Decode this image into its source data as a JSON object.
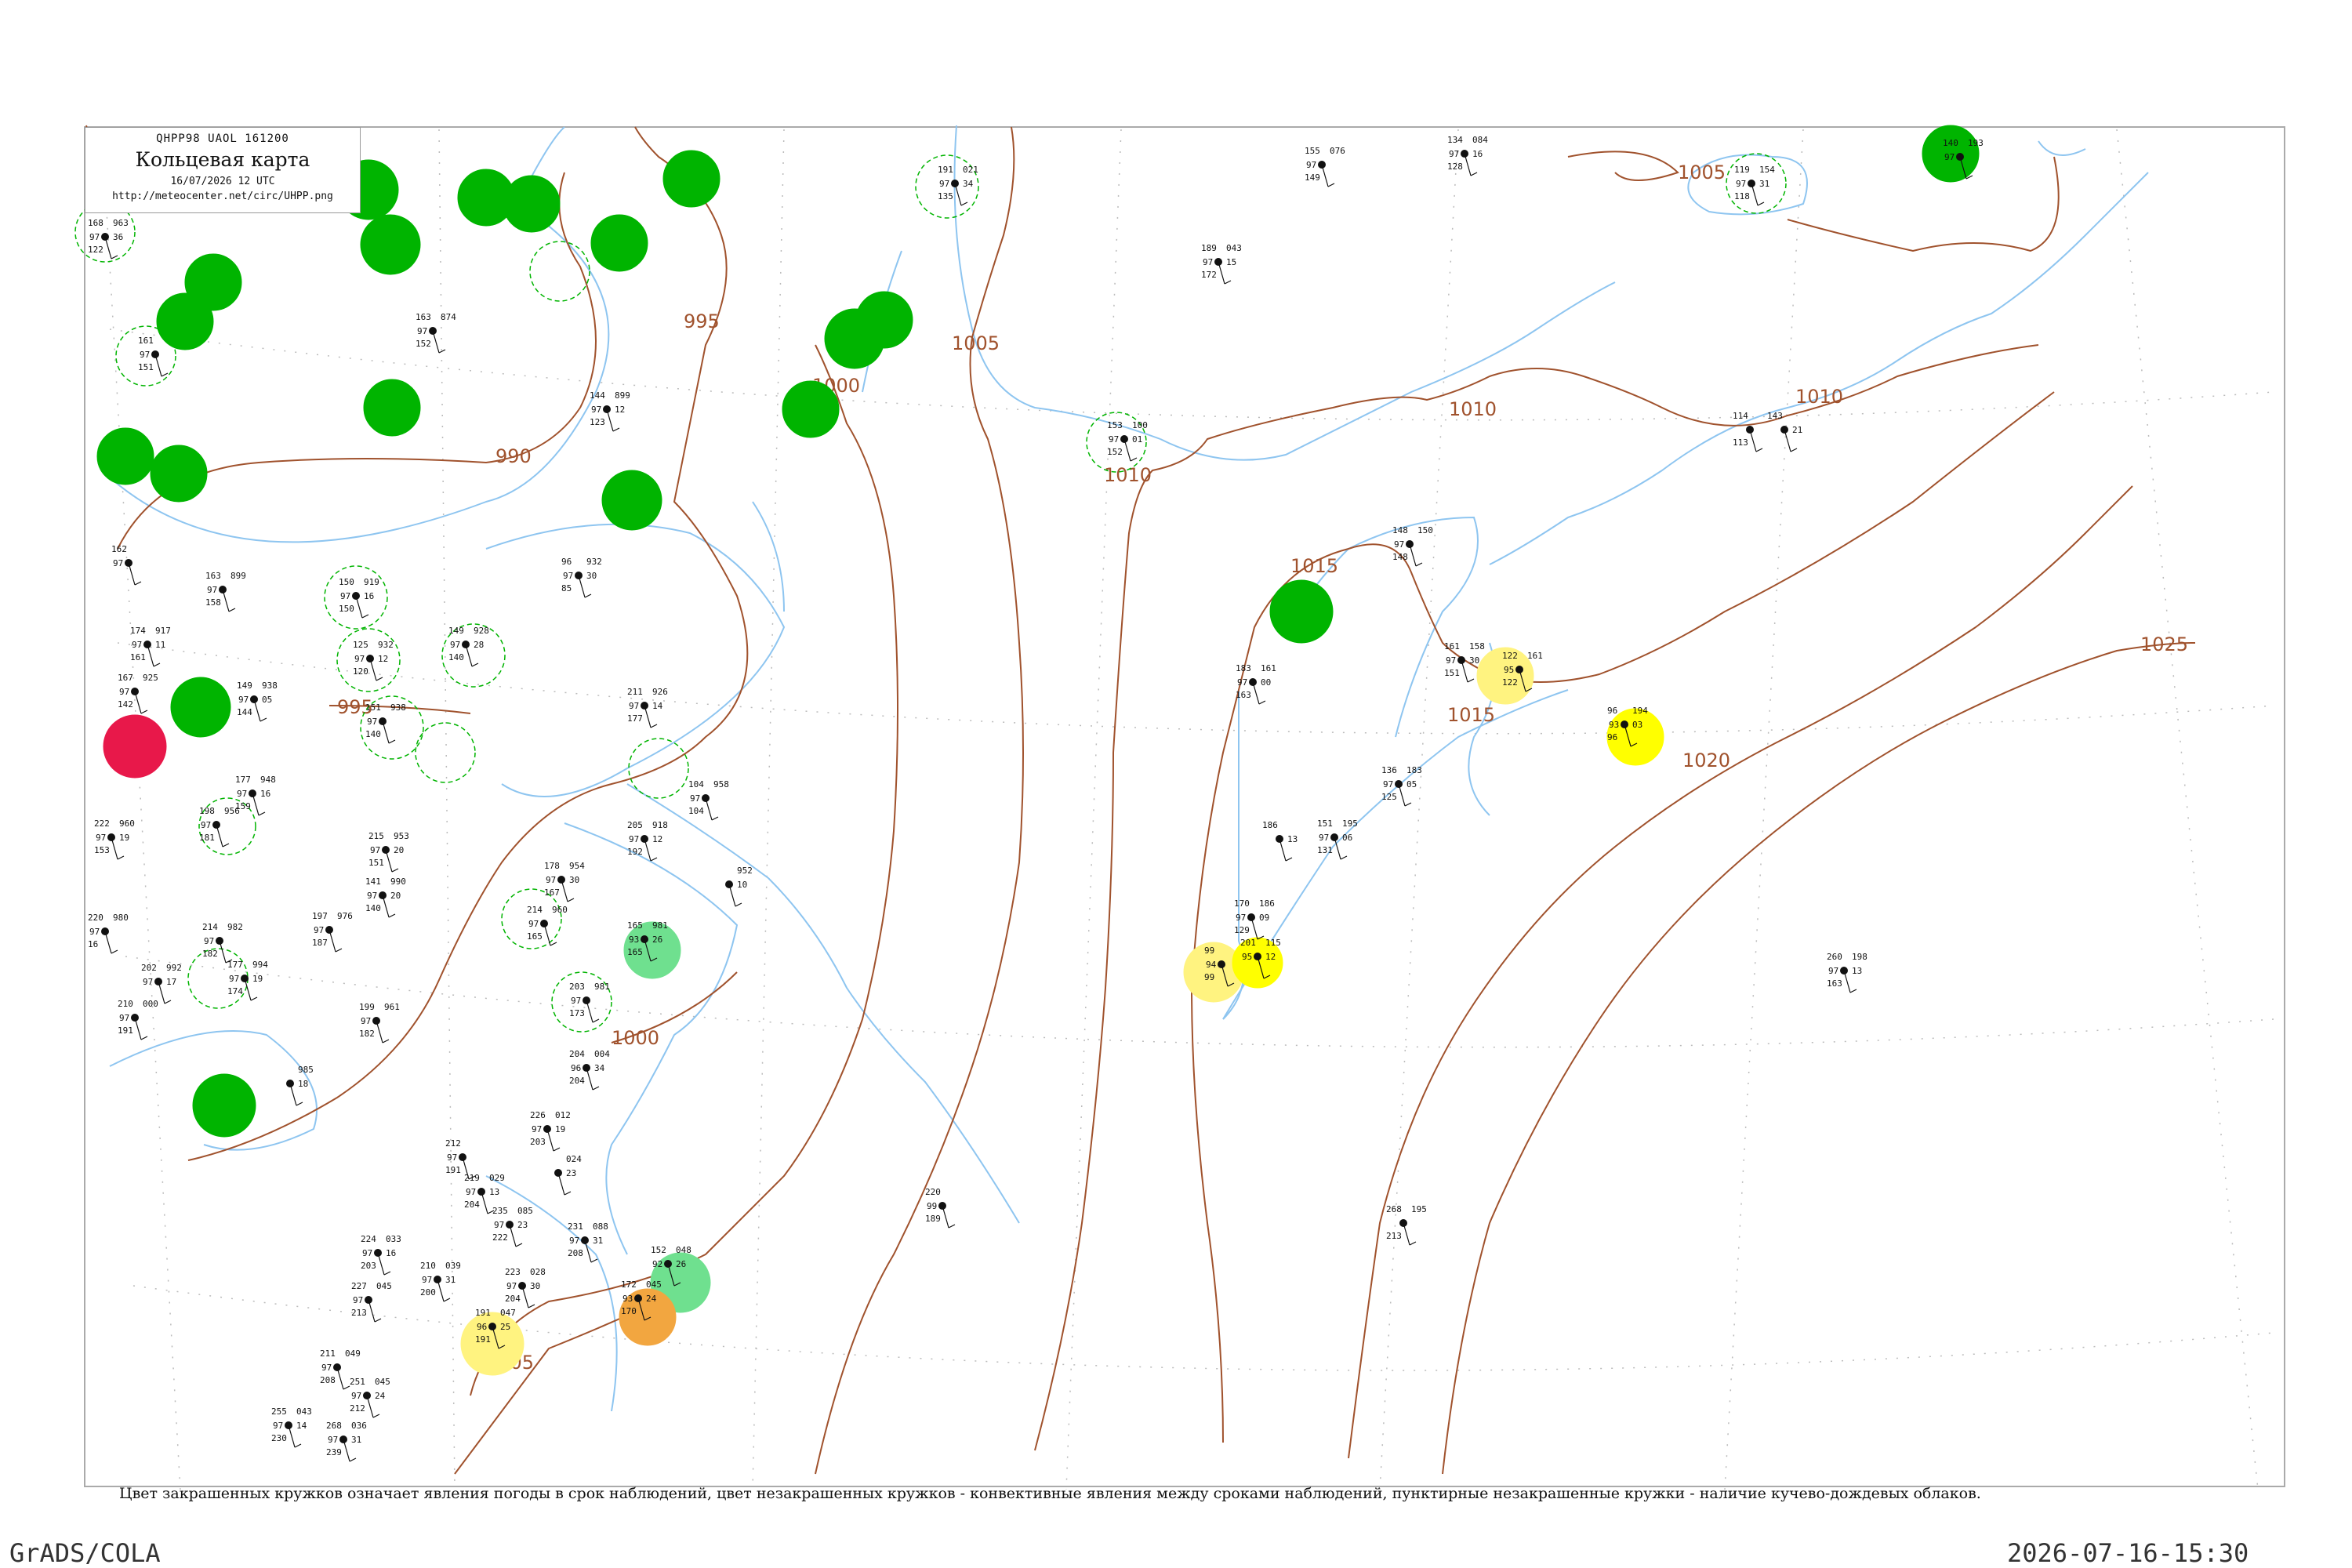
{
  "legend": {
    "code_line": "QHPP98  UAOL  161200",
    "title": "Кольцевая карта",
    "date_line": "16/07/2026 12 UTC",
    "url": "http://meteocenter.net/circ/UHPP.png"
  },
  "caption": "Цвет закрашенных кружков означает явления погоды в срок наблюдений, цвет незакрашенных кружков - конвективные явления между сроками наблюдений, пунктирные незакрашенные кружки - наличие кучево-дождевых облаков.",
  "footer": {
    "left": "GrADS/COLA",
    "right": "2026-07-16-15:30"
  },
  "colors": {
    "isobar": "#a0522d",
    "water": "#8ec5f0",
    "rain_fill": "#00b400",
    "thunder_fill": "#e8184a",
    "fog_fill": "#ffff00",
    "light_yellow_fill": "#fff380",
    "orange_fill": "#f2a640",
    "light_green_fill": "#6fe08f"
  },
  "isobars": [
    {
      "label": "990"
    },
    {
      "label": "995"
    },
    {
      "label": "1000"
    },
    {
      "label": "1005"
    },
    {
      "label": "1010"
    },
    {
      "label": "1015"
    },
    {
      "label": "1020"
    },
    {
      "label": "1025"
    }
  ],
  "stations": [
    {
      "top": "963",
      "left": "168",
      "mid": "97",
      "right": "36",
      "bottom": "122"
    },
    {
      "top": "874",
      "left": "163",
      "mid": "97",
      "right": "",
      "bottom": "152"
    },
    {
      "top": "",
      "left": "161",
      "mid": "97",
      "right": "",
      "bottom": "151"
    },
    {
      "top": "899",
      "left": "144",
      "mid": "97",
      "right": "12",
      "bottom": "123"
    },
    {
      "top": "021",
      "left": "191",
      "mid": "97",
      "right": "34",
      "bottom": "135"
    },
    {
      "top": "076",
      "left": "155",
      "mid": "97",
      "right": "",
      "bottom": "149"
    },
    {
      "top": "084",
      "left": "134",
      "mid": "97",
      "right": "16",
      "bottom": "128"
    },
    {
      "top": "043",
      "left": "189",
      "mid": "97",
      "right": "15",
      "bottom": "172"
    },
    {
      "top": "154",
      "left": "119",
      "mid": "97",
      "right": "31",
      "bottom": "118"
    },
    {
      "top": "193",
      "left": "140",
      "mid": "97",
      "right": "",
      "bottom": ""
    },
    {
      "top": "100",
      "left": "153",
      "mid": "97",
      "right": "01",
      "bottom": "152"
    },
    {
      "top": "",
      "left": "114",
      "mid": "",
      "right": "",
      "bottom": "113"
    },
    {
      "top": "",
      "left": "143",
      "mid": "",
      "right": "21",
      "bottom": ""
    },
    {
      "top": "150",
      "left": "148",
      "mid": "97",
      "right": "",
      "bottom": "148"
    },
    {
      "top": "932",
      "left": "96",
      "mid": "97",
      "right": "30",
      "bottom": "85"
    },
    {
      "top": "899",
      "left": "163",
      "mid": "97",
      "right": "",
      "bottom": "158"
    },
    {
      "top": "919",
      "left": "150",
      "mid": "97",
      "right": "16",
      "bottom": "150"
    },
    {
      "top": "932",
      "left": "125",
      "mid": "97",
      "right": "12",
      "bottom": "120"
    },
    {
      "top": "928",
      "left": "149",
      "mid": "97",
      "right": "28",
      "bottom": "140"
    },
    {
      "top": "",
      "left": "162",
      "mid": "97",
      "right": "",
      "bottom": ""
    },
    {
      "top": "917",
      "left": "174",
      "mid": "97",
      "right": "11",
      "bottom": "161"
    },
    {
      "top": "925",
      "left": "167",
      "mid": "97",
      "right": "",
      "bottom": "142"
    },
    {
      "top": "938",
      "left": "149",
      "mid": "97",
      "right": "05",
      "bottom": "144"
    },
    {
      "top": "938",
      "left": "151",
      "mid": "97",
      "right": "",
      "bottom": "140"
    },
    {
      "top": "926",
      "left": "211",
      "mid": "97",
      "right": "14",
      "bottom": "177"
    },
    {
      "top": "948",
      "left": "177",
      "mid": "97",
      "right": "16",
      "bottom": "159"
    },
    {
      "top": "956",
      "left": "198",
      "mid": "97",
      "right": "",
      "bottom": "181"
    },
    {
      "top": "960",
      "left": "222",
      "mid": "97",
      "right": "19",
      "bottom": "153"
    },
    {
      "top": "953",
      "left": "215",
      "mid": "97",
      "right": "20",
      "bottom": "151"
    },
    {
      "top": "990",
      "left": "141",
      "mid": "97",
      "right": "20",
      "bottom": "140"
    },
    {
      "top": "976",
      "left": "197",
      "mid": "97",
      "right": "",
      "bottom": "187"
    },
    {
      "top": "982",
      "left": "214",
      "mid": "97",
      "right": "",
      "bottom": "182"
    },
    {
      "top": "994",
      "left": "177",
      "mid": "97",
      "right": "19",
      "bottom": "174"
    },
    {
      "top": "992",
      "left": "202",
      "mid": "97",
      "right": "17",
      "bottom": ""
    },
    {
      "top": "000",
      "left": "210",
      "mid": "97",
      "right": "",
      "bottom": "191"
    },
    {
      "top": "980",
      "left": "220",
      "mid": "97",
      "right": "",
      "bottom": "16"
    },
    {
      "top": "961",
      "left": "199",
      "mid": "97",
      "right": "",
      "bottom": "182"
    },
    {
      "top": "985",
      "left": "",
      "mid": "",
      "right": "18",
      "bottom": ""
    },
    {
      "top": "954",
      "left": "178",
      "mid": "97",
      "right": "30",
      "bottom": "167"
    },
    {
      "top": "960",
      "left": "214",
      "mid": "97",
      "right": "",
      "bottom": "165"
    },
    {
      "top": "981",
      "left": "203",
      "mid": "97",
      "right": "",
      "bottom": "173"
    },
    {
      "top": "004",
      "left": "204",
      "mid": "96",
      "right": "34",
      "bottom": "204"
    },
    {
      "top": "918",
      "left": "205",
      "mid": "97",
      "right": "12",
      "bottom": "192"
    },
    {
      "top": "958",
      "left": "104",
      "mid": "97",
      "right": "",
      "bottom": "104"
    },
    {
      "top": "981",
      "left": "165",
      "mid": "93",
      "right": "26",
      "bottom": "165"
    },
    {
      "top": "952",
      "left": "",
      "mid": "",
      "right": "10",
      "bottom": ""
    },
    {
      "top": "012",
      "left": "226",
      "mid": "97",
      "right": "19",
      "bottom": "203"
    },
    {
      "top": "",
      "left": "212",
      "mid": "97",
      "right": "",
      "bottom": "191"
    },
    {
      "top": "024",
      "left": "",
      "mid": "",
      "right": "23",
      "bottom": ""
    },
    {
      "top": "029",
      "left": "219",
      "mid": "97",
      "right": "13",
      "bottom": "204"
    },
    {
      "top": "085",
      "left": "235",
      "mid": "97",
      "right": "23",
      "bottom": "222"
    },
    {
      "top": "088",
      "left": "231",
      "mid": "97",
      "right": "31",
      "bottom": "208"
    },
    {
      "top": "033",
      "left": "224",
      "mid": "97",
      "right": "16",
      "bottom": "203"
    },
    {
      "top": "039",
      "left": "210",
      "mid": "97",
      "right": "31",
      "bottom": "200"
    },
    {
      "top": "028",
      "left": "223",
      "mid": "97",
      "right": "30",
      "bottom": "204"
    },
    {
      "top": "048",
      "left": "152",
      "mid": "92",
      "right": "26",
      "bottom": ""
    },
    {
      "top": "045",
      "left": "172",
      "mid": "93",
      "right": "24",
      "bottom": "170"
    },
    {
      "top": "047",
      "left": "191",
      "mid": "96",
      "right": "25",
      "bottom": "191"
    },
    {
      "top": "045",
      "left": "227",
      "mid": "97",
      "right": "",
      "bottom": "213"
    },
    {
      "top": "049",
      "left": "211",
      "mid": "97",
      "right": "",
      "bottom": "208"
    },
    {
      "top": "043",
      "left": "255",
      "mid": "97",
      "right": "14",
      "bottom": "230"
    },
    {
      "top": "045",
      "left": "251",
      "mid": "97",
      "right": "24",
      "bottom": "212"
    },
    {
      "top": "036",
      "left": "268",
      "mid": "97",
      "right": "31",
      "bottom": "239"
    },
    {
      "top": "",
      "left": "220",
      "mid": "99",
      "right": "",
      "bottom": "189"
    },
    {
      "top": "195",
      "left": "268",
      "mid": "",
      "right": "",
      "bottom": "213"
    },
    {
      "top": "161",
      "left": "183",
      "mid": "97",
      "right": "00",
      "bottom": "163"
    },
    {
      "top": "",
      "left": "186",
      "mid": "",
      "right": "13",
      "bottom": ""
    },
    {
      "top": "195",
      "left": "151",
      "mid": "97",
      "right": "06",
      "bottom": "131"
    },
    {
      "top": "186",
      "left": "170",
      "mid": "97",
      "right": "09",
      "bottom": "129"
    },
    {
      "top": "",
      "left": "99",
      "mid": "94",
      "right": "",
      "bottom": "99"
    },
    {
      "top": "115",
      "left": "201",
      "mid": "95",
      "right": "12",
      "bottom": ""
    },
    {
      "top": "158",
      "left": "161",
      "mid": "97",
      "right": "30",
      "bottom": "151"
    },
    {
      "top": "161",
      "left": "122",
      "mid": "95",
      "right": "",
      "bottom": "122"
    },
    {
      "top": "194",
      "left": "96",
      "mid": "93",
      "right": "03",
      "bottom": "96"
    },
    {
      "top": "183",
      "left": "136",
      "mid": "97",
      "right": "05",
      "bottom": "125"
    },
    {
      "top": "198",
      "left": "260",
      "mid": "97",
      "right": "13",
      "bottom": "163"
    }
  ]
}
